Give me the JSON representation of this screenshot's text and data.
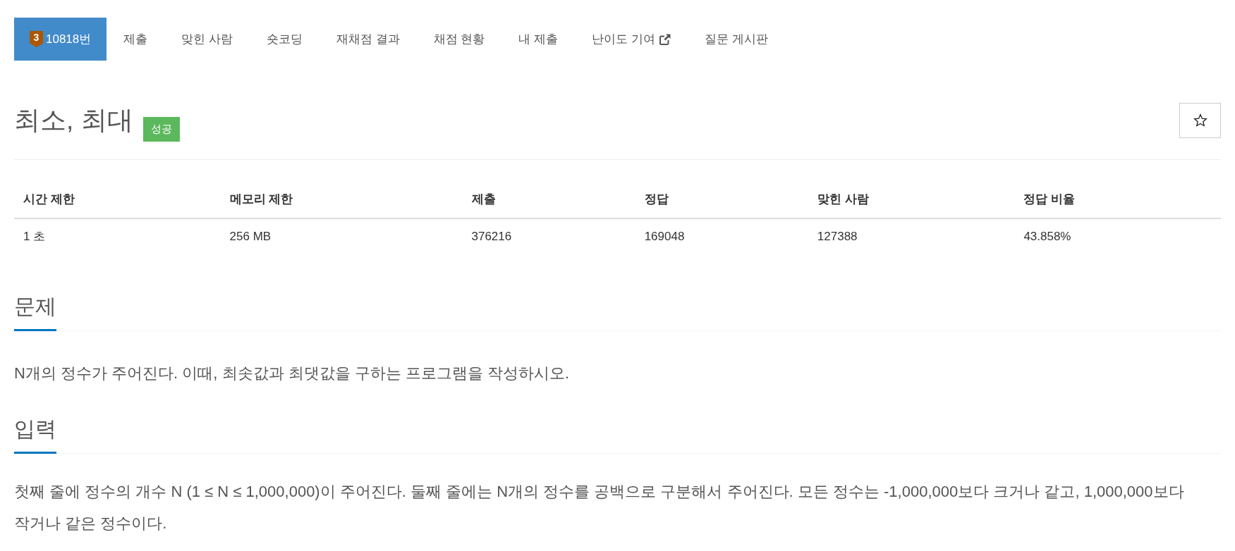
{
  "tabs": [
    {
      "label": "10818번",
      "selected": true,
      "tier": "3",
      "external": false
    },
    {
      "label": "제출",
      "selected": false,
      "external": false
    },
    {
      "label": "맞힌 사람",
      "selected": false,
      "external": false
    },
    {
      "label": "숏코딩",
      "selected": false,
      "external": false
    },
    {
      "label": "재채점 결과",
      "selected": false,
      "external": false
    },
    {
      "label": "채점 현황",
      "selected": false,
      "external": false
    },
    {
      "label": "내 제출",
      "selected": false,
      "external": false
    },
    {
      "label": "난이도 기여",
      "selected": false,
      "external": true
    },
    {
      "label": "질문 게시판",
      "selected": false,
      "external": false
    }
  ],
  "problem": {
    "title": "최소, 최대",
    "status_badge": "성공",
    "starred": false
  },
  "info_table": {
    "columns": [
      "시간 제한",
      "메모리 제한",
      "제출",
      "정답",
      "맞힌 사람",
      "정답 비율"
    ],
    "rows": [
      [
        "1 초",
        "256 MB",
        "376216",
        "169048",
        "127388",
        "43.858%"
      ]
    ]
  },
  "sections": [
    {
      "heading": "문제",
      "text": "N개의 정수가 주어진다. 이때, 최솟값과 최댓값을 구하는 프로그램을 작성하시오."
    },
    {
      "heading": "입력",
      "text": "첫째 줄에 정수의 개수 N (1 ≤ N ≤ 1,000,000)이 주어진다. 둘째 줄에는 N개의 정수를 공백으로 구분해서 주어진다. 모든 정수는 -1,000,000보다 크거나 같고, 1,000,000보다 작거나 같은 정수이다."
    }
  ]
}
